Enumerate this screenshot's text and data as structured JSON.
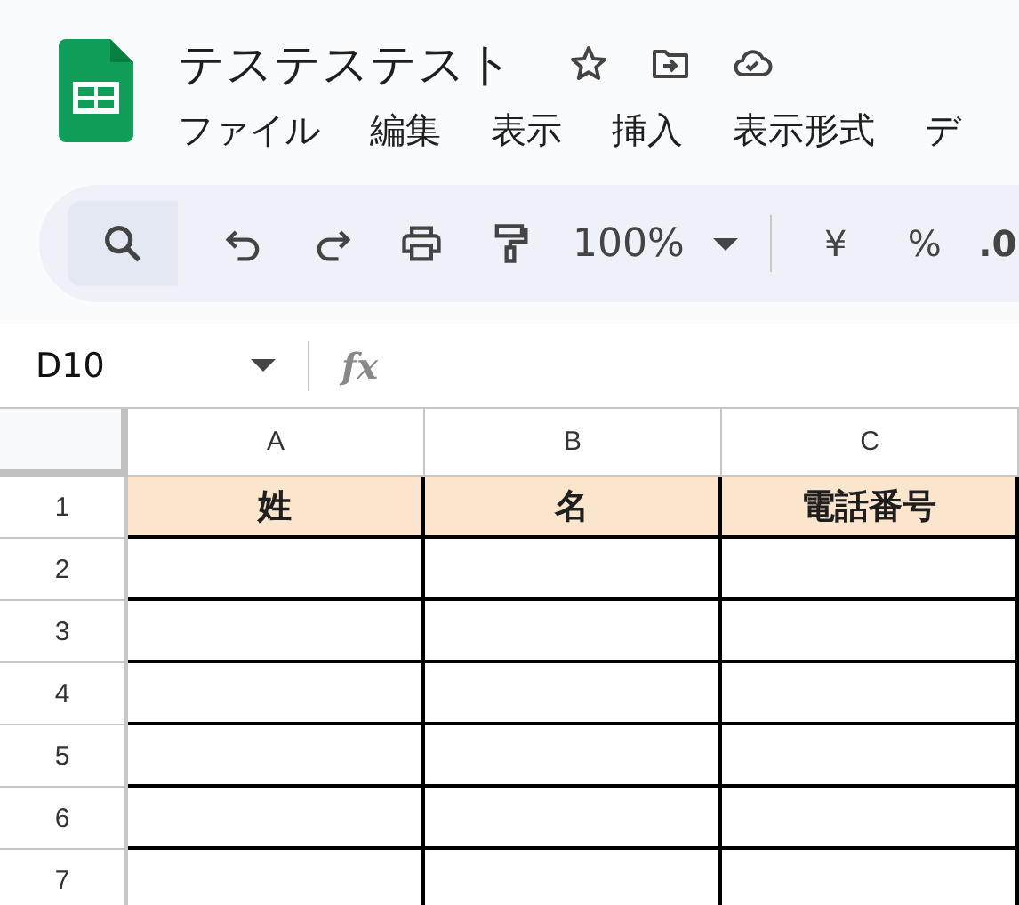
{
  "document": {
    "title": "テステステスト"
  },
  "menu": [
    "ファイル",
    "編集",
    "表示",
    "挿入",
    "表示形式",
    "デ"
  ],
  "toolbar": {
    "zoom": "100%",
    "currency": "¥",
    "percent": "%",
    "decimal": ".0"
  },
  "formula_bar": {
    "cell_ref": "D10",
    "fx": "fx"
  },
  "grid": {
    "columns": [
      "A",
      "B",
      "C"
    ],
    "rows": [
      {
        "number": "1",
        "cells": [
          "姓",
          "名",
          "電話番号"
        ]
      },
      {
        "number": "2"
      },
      {
        "number": "3"
      },
      {
        "number": "4"
      },
      {
        "number": "5"
      },
      {
        "number": "6"
      },
      {
        "number": "7"
      }
    ]
  }
}
